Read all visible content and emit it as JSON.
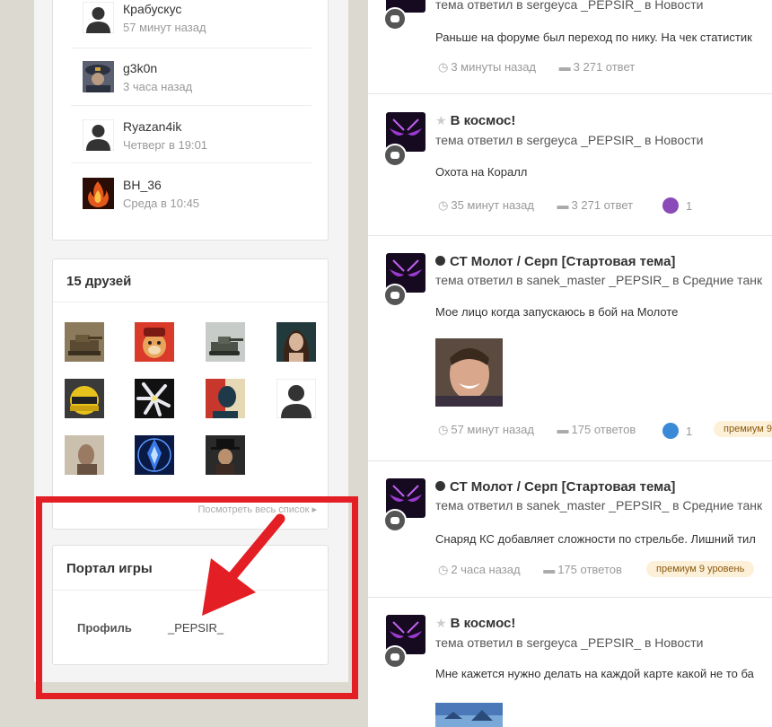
{
  "visitors": [
    {
      "name": "Крабускус",
      "time": "57 минут назад",
      "avatar": "default-avatar"
    },
    {
      "name": "g3k0n",
      "time": "3 часа назад",
      "avatar": "military-avatar"
    },
    {
      "name": "Ryazan4ik",
      "time": "Четверг в 19:01",
      "avatar": "default-avatar"
    },
    {
      "name": "BH_36",
      "time": "Среда в 10:45",
      "avatar": "fire-avatar"
    }
  ],
  "friends": {
    "title": "15 друзей",
    "view_all": "Посмотреть весь список"
  },
  "portal": {
    "title": "Портал игры",
    "profile_label": "Профиль",
    "profile_value": "_PEPSIR_"
  },
  "feed": [
    {
      "title": "",
      "subtitle": "тема ответил в sergeyca _PEPSIR_ в Новости",
      "body": "Раньше на форуме был переход по нику. На чек статистик",
      "time": "3 минуты назад",
      "replies": "3 271 ответ"
    },
    {
      "title": "В космос!",
      "subtitle": "тема ответил в sergeyca _PEPSIR_ в Новости",
      "body": "Охота на Коралл",
      "time": "35 минут назад",
      "replies": "3 271 ответ",
      "reaction_count": "1"
    },
    {
      "title": "СТ Молот / Серп [Стартовая тема]",
      "subtitle": "тема ответил в sanek_master _PEPSIR_ в Средние танк",
      "body": "Мое лицо когда запускаюсь в бой на Молоте",
      "time": "57 минут назад",
      "replies": "175 ответов",
      "reaction_count": "1",
      "badge": "премиум 9"
    },
    {
      "title": "СТ Молот / Серп [Стартовая тема]",
      "subtitle": "тема ответил в sanek_master _PEPSIR_ в Средние танк",
      "body": "Снаряд КС добавляет сложности по стрельбе. Лишний тил",
      "time": "2 часа назад",
      "replies": "175 ответов",
      "badge": "премиум 9 уровень"
    },
    {
      "title": "В космос!",
      "subtitle": "тема ответил в sergeyca _PEPSIR_ в Новости",
      "body": "Мне кажется нужно делать на каждой карте какой не то ба"
    }
  ],
  "colors": {
    "accent_red": "#e31e24",
    "avatar_purple": "#7a2ab0",
    "badge_bg": "#fdf0d8"
  }
}
